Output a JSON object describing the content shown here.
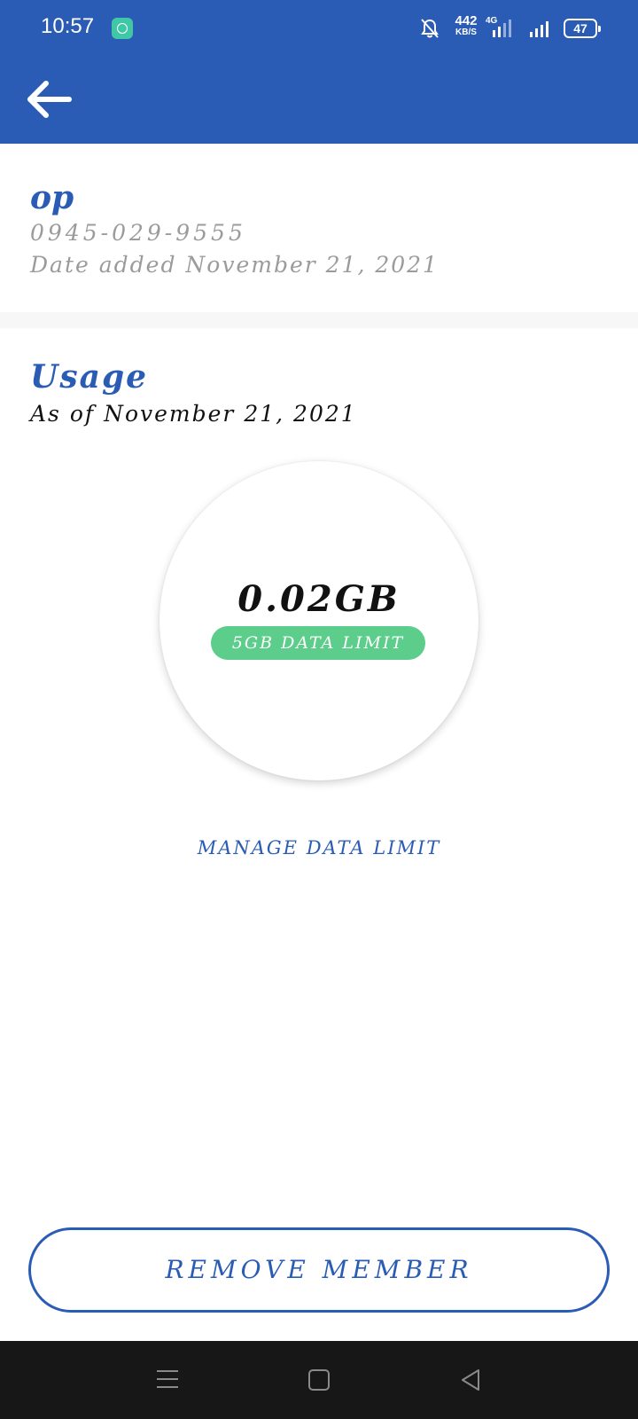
{
  "status_bar": {
    "time": "10:57",
    "net_speed_value": "442",
    "net_speed_unit": "KB/S",
    "network_type": "4G",
    "battery": "47"
  },
  "member": {
    "name": "op",
    "phone": "0945-029-9555",
    "date_added": "Date added November 21, 2021"
  },
  "usage": {
    "title": "Usage",
    "as_of": "As of November 21, 2021",
    "amount": "0.02GB",
    "limit_label": "5GB DATA LIMIT"
  },
  "actions": {
    "manage_data_limit": "MANAGE DATA LIMIT",
    "remove_member": "REMOVE MEMBER"
  },
  "colors": {
    "primary": "#2a5cb5",
    "badge_green": "#5ccd8a",
    "nav_bar": "#171717"
  },
  "icons": {
    "back": "arrow-left-icon",
    "notification_muted": "bell-off-icon",
    "nav_menu": "menu-icon",
    "nav_home": "square-icon",
    "nav_back": "triangle-back-icon"
  }
}
